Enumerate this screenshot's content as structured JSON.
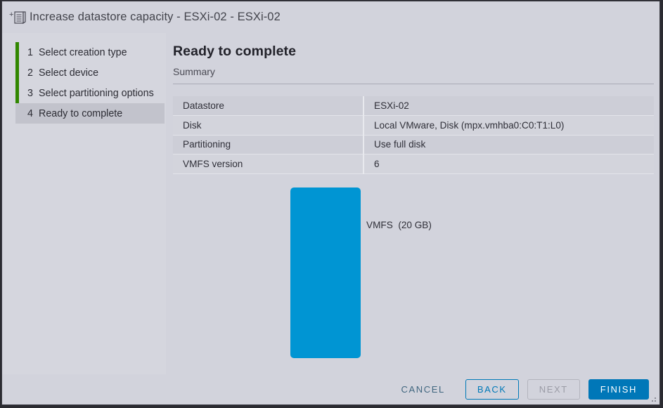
{
  "window": {
    "title": "Increase datastore capacity - ESXi-02 - ESXi-02",
    "icon": "new-datastore-icon"
  },
  "sidebar": {
    "steps": [
      {
        "num": "1",
        "label": "Select creation type",
        "active": false
      },
      {
        "num": "2",
        "label": "Select device",
        "active": false
      },
      {
        "num": "3",
        "label": "Select partitioning options",
        "active": false
      },
      {
        "num": "4",
        "label": "Ready to complete",
        "active": true
      }
    ],
    "accent_color": "#318700"
  },
  "content": {
    "page_title": "Ready to complete",
    "section_label": "Summary",
    "summary_rows": [
      {
        "key": "Datastore",
        "value": "ESXi-02"
      },
      {
        "key": "Disk",
        "value": "Local VMware, Disk (mpx.vmhba0:C0:T1:L0)"
      },
      {
        "key": "Partitioning",
        "value": "Use full disk"
      },
      {
        "key": "VMFS version",
        "value": "6"
      }
    ],
    "diagram": {
      "partition_label": "VMFS  (20 GB)",
      "partition_name": "VMFS",
      "partition_size": "20 GB",
      "partition_color": "#0095d3"
    }
  },
  "footer": {
    "cancel_label": "CANCEL",
    "back_label": "BACK",
    "next_label": "NEXT",
    "finish_label": "FINISH",
    "primary_color": "#0077b8"
  }
}
